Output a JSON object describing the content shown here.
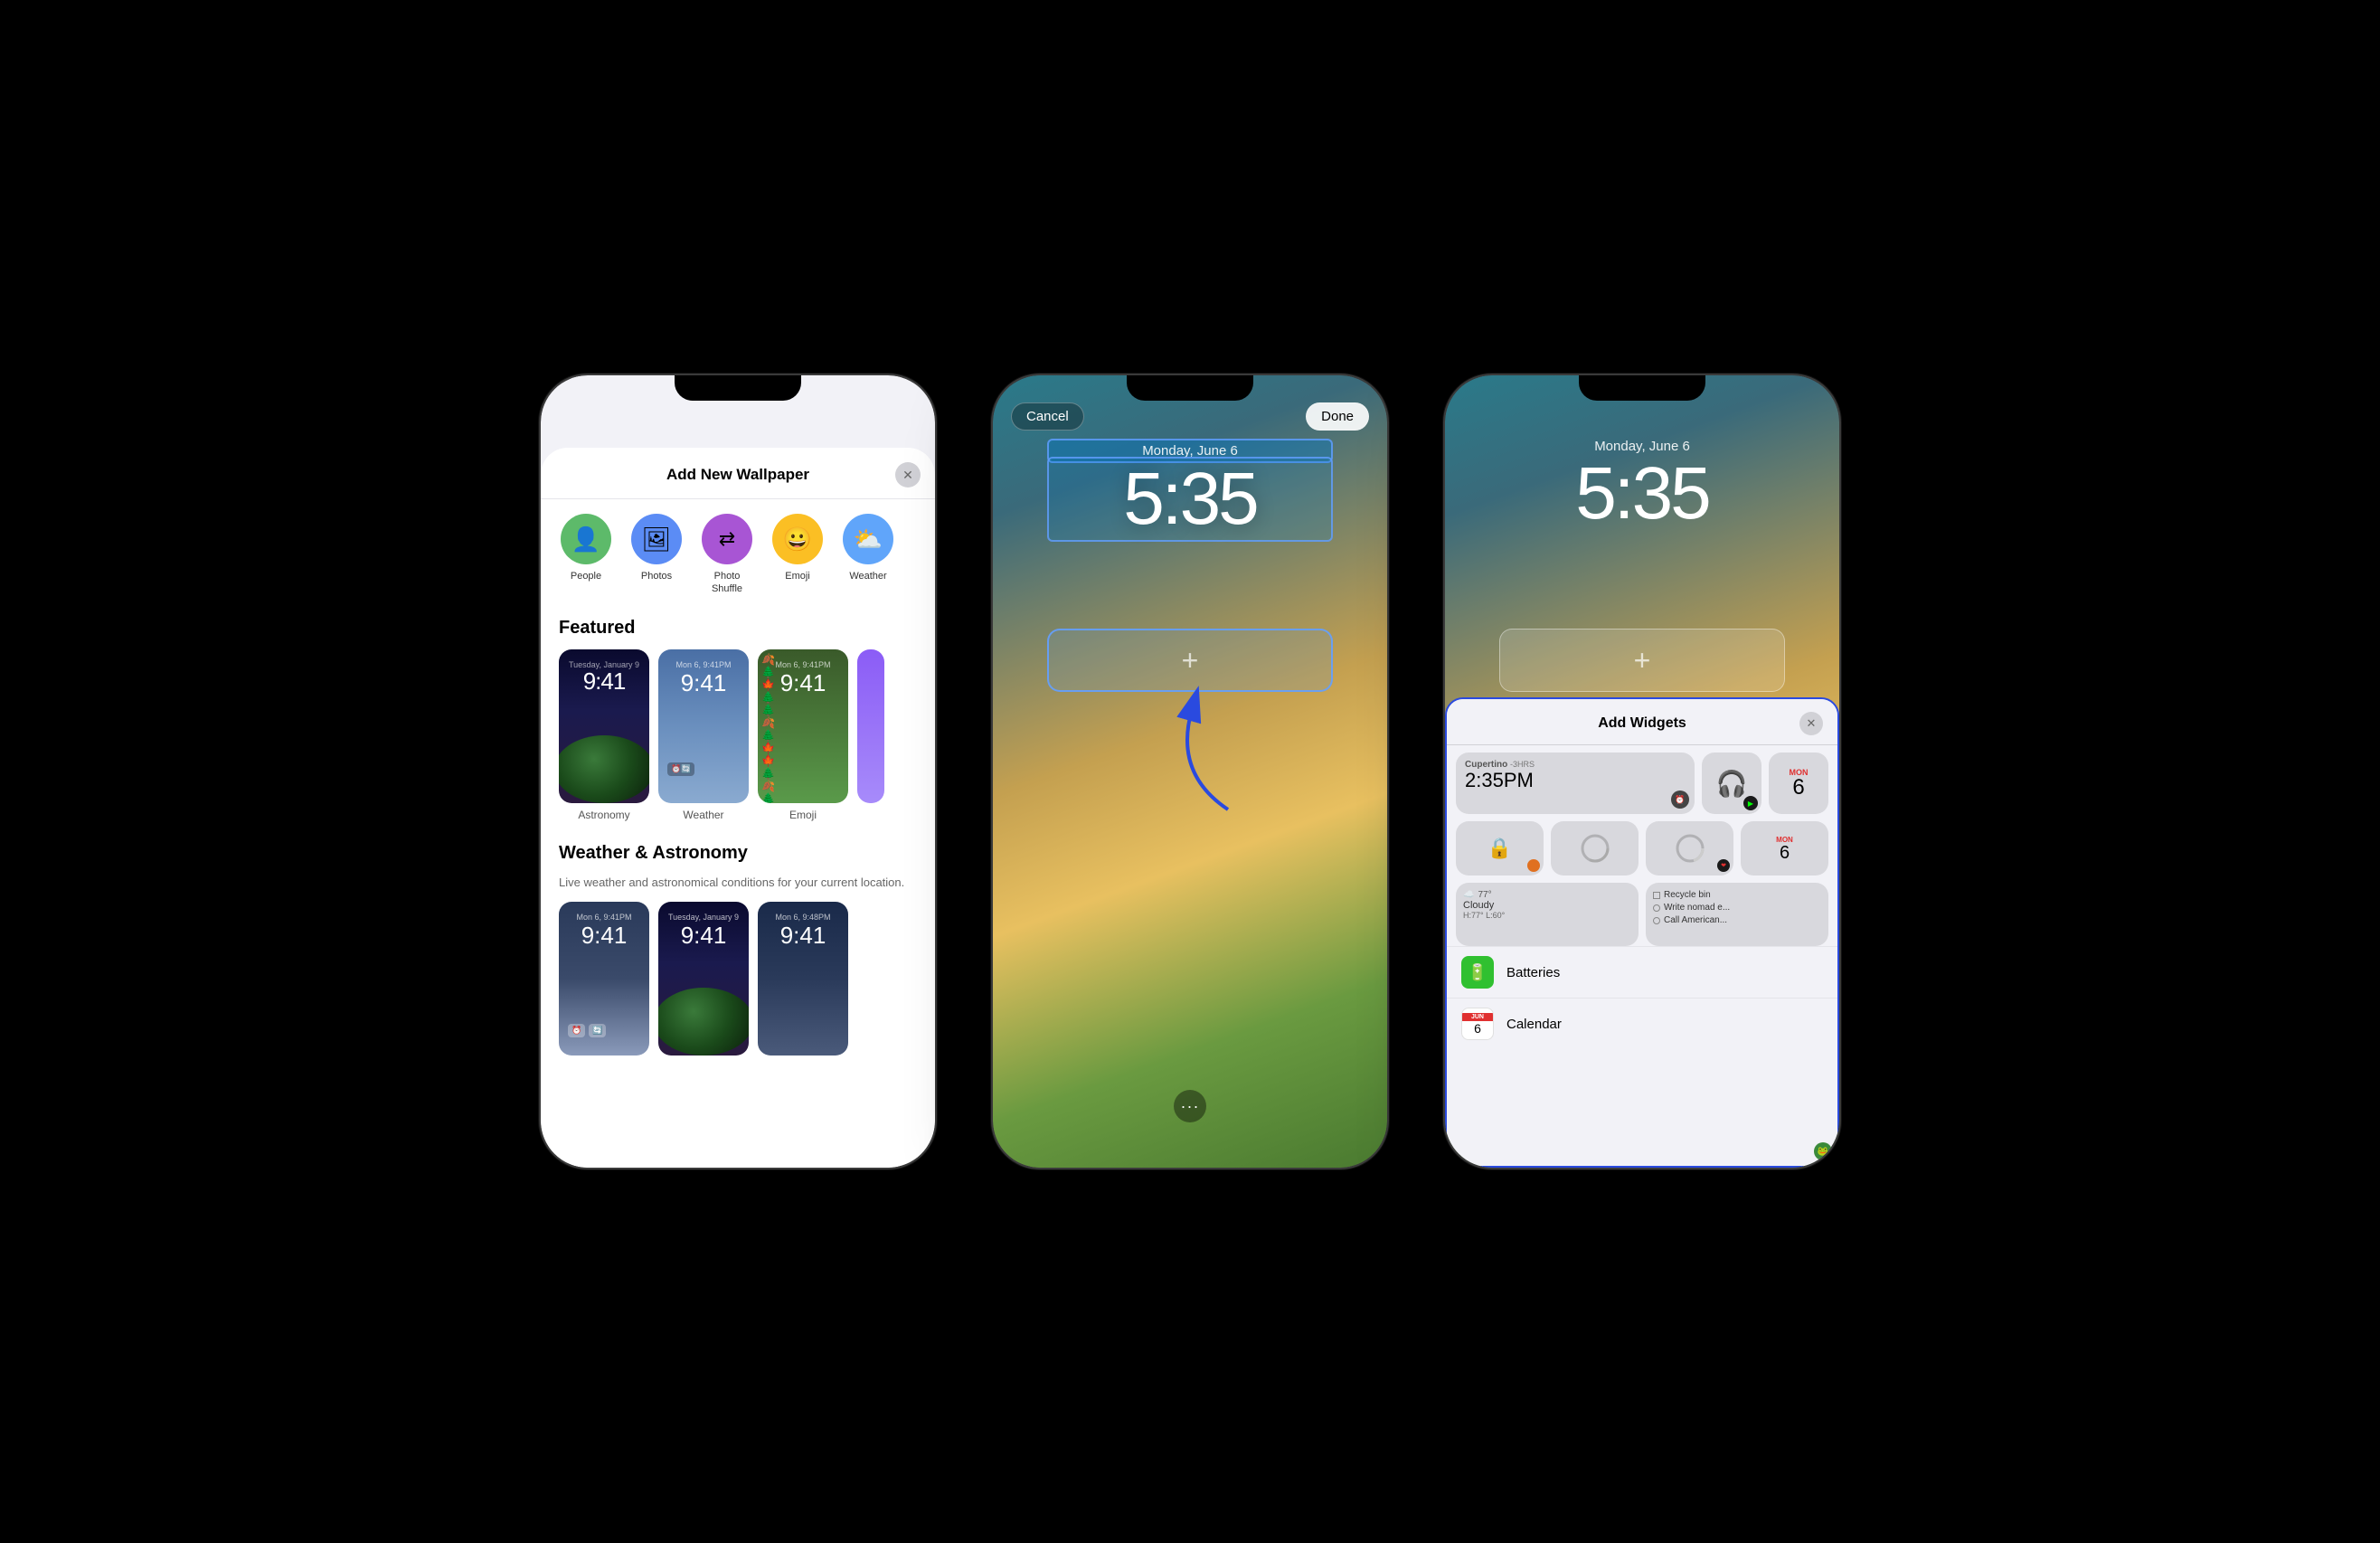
{
  "phone1": {
    "modal_title": "Add New Wallpaper",
    "close_icon": "✕",
    "options": [
      {
        "label": "People",
        "icon": "👤",
        "bg": "#5dba6a"
      },
      {
        "label": "Photos",
        "icon": "🖼",
        "bg": "#5b8cf5"
      },
      {
        "label": "Photo\nShuffle",
        "icon": "⇄",
        "bg": "#a855d4"
      },
      {
        "label": "Emoji",
        "icon": "😀",
        "bg": "#fbbf24"
      },
      {
        "label": "Weather",
        "icon": "⛅",
        "bg": "#60a5fa"
      }
    ],
    "featured_title": "Featured",
    "featured_items": [
      {
        "label": "Astronomy"
      },
      {
        "label": "Weather"
      },
      {
        "label": "Emoji"
      }
    ],
    "weather_section_title": "Weather & Astronomy",
    "weather_section_desc": "Live weather and astronomical conditions for your current location."
  },
  "phone2": {
    "cancel_label": "Cancel",
    "done_label": "Done",
    "date": "Monday, June 6",
    "time": "5:35",
    "plus_icon": "+",
    "dots_icon": "···"
  },
  "phone3": {
    "date": "Monday, June 6",
    "time": "5:35",
    "plus_icon": "+",
    "panel_title": "Add Widgets",
    "close_icon": "✕",
    "widget_city": "Cupertino",
    "widget_badge": "-3HRS",
    "widget_time": "2:35PM",
    "widget_temp": "77°",
    "widget_condition": "Cloudy",
    "widget_hi_lo": "H:77° L:60°",
    "reminder1": "Recycle bin",
    "reminder2": "Write nomad e...",
    "reminder3": "Call American...",
    "cal_day": "MON",
    "cal_num": "6",
    "cal_label": "MON\n6",
    "batteries_label": "Batteries",
    "calendar_label": "Calendar"
  }
}
